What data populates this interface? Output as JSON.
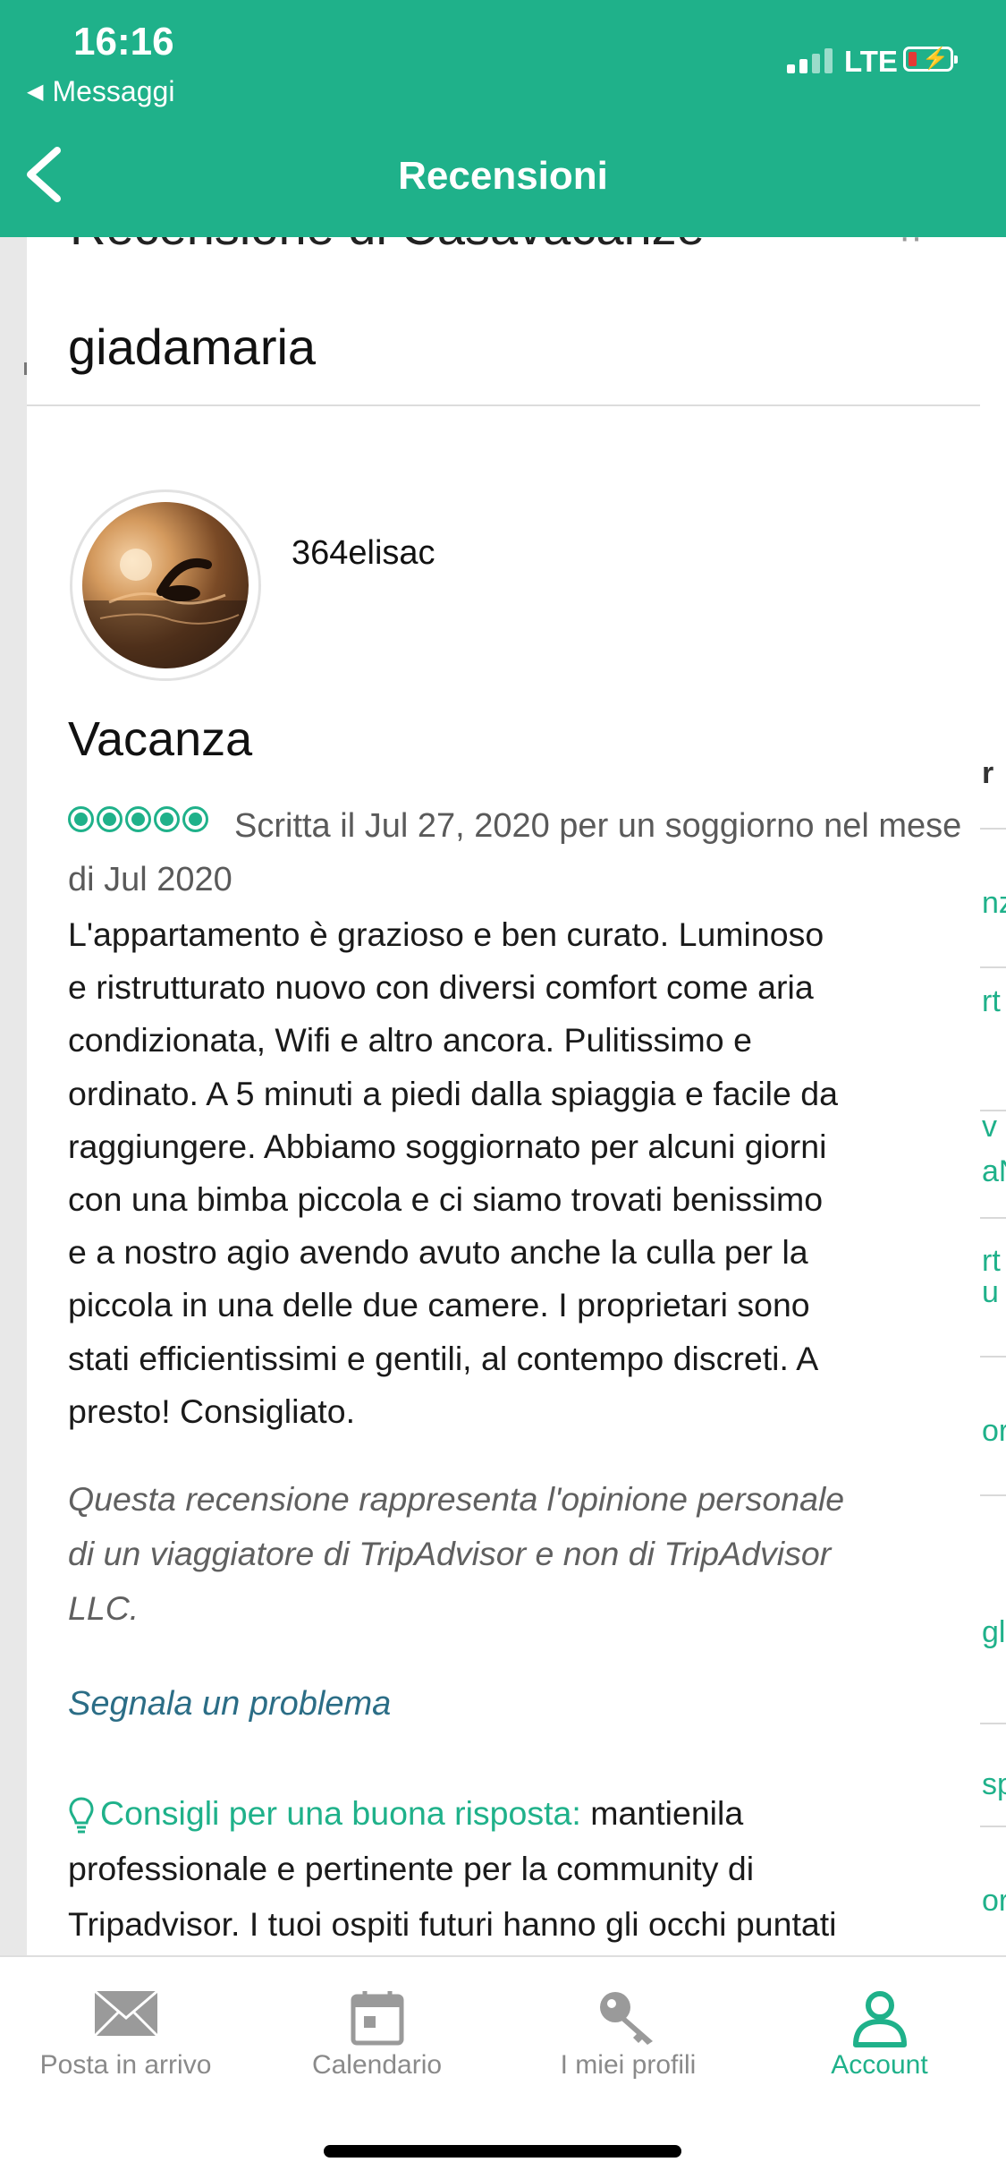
{
  "status_bar": {
    "time": "16:16",
    "back_app_label": "Messaggi",
    "network": "LTE",
    "colors": {
      "bar": "#1fb18a",
      "battery_low": "#e53935"
    }
  },
  "header": {
    "title": "Recensioni",
    "back_icon": "chevron-left-icon"
  },
  "card": {
    "title_cut": "Recensione di Casavacanze",
    "title": "giadamaria",
    "reviewer": {
      "username": "364elisac",
      "avatar_icon": "swimmer-photo"
    },
    "review": {
      "title": "Vacanza",
      "rating": 5,
      "meta": "Scritta il Jul 27, 2020 per un soggiorno nel mese di Jul 2020",
      "body": "L'appartamento è grazioso e ben curato. Luminoso\ne ristrutturato nuovo con diversi comfort come aria\ncondizionata, Wifi e altro ancora. Pulitissimo e\nordinato. A 5 minuti a piedi dalla spiaggia e facile da\nraggiungere. Abbiamo soggiornato per alcuni giorni\ncon una bimba piccola e ci siamo trovati benissimo\ne a nostro agio avendo avuto anche la culla per la\npiccola in una delle due camere. I proprietari sono\nstati efficientissimi e gentili, al contempo discreti. A\npresto! Consigliato.",
      "disclaimer": "Questa recensione rappresenta l'opinione personale\ndi un viaggiatore di TripAdvisor e non di TripAdvisor\nLLC.",
      "report_link": "Segnala un problema"
    },
    "tips": {
      "label": "Consigli per una buona risposta:",
      "text": " mantienila\nprofessionale e pertinente per la community di\nTripadvisor. I tuoi ospiti futuri hanno gli occhi puntati"
    }
  },
  "tabs": [
    {
      "label": "Posta in arrivo",
      "icon": "envelope-icon",
      "active": false
    },
    {
      "label": "Calendario",
      "icon": "calendar-icon",
      "active": false
    },
    {
      "label": "I miei profili",
      "icon": "key-icon",
      "active": false
    },
    {
      "label": "Account",
      "icon": "person-icon",
      "active": true
    }
  ],
  "colors": {
    "accent": "#1fb18a",
    "link": "#2b6d86"
  }
}
